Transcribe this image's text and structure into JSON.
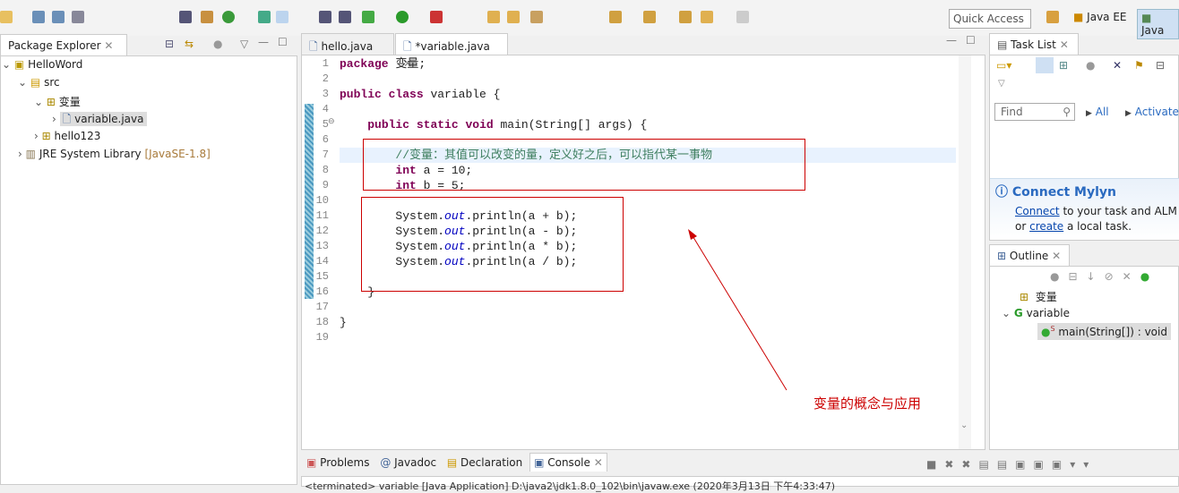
{
  "toolbar": {
    "quick_access": "Quick Access",
    "perspectives": [
      "Java EE",
      "Java"
    ]
  },
  "package_explorer": {
    "title": "Package Explorer",
    "tree": [
      {
        "label": "HelloWord",
        "depth": 0
      },
      {
        "label": "src",
        "depth": 1
      },
      {
        "label": "变量",
        "depth": 2
      },
      {
        "label": "variable.java",
        "depth": 3
      },
      {
        "label": "hello123",
        "depth": 2
      },
      {
        "label": "JRE System Library",
        "suffix": "[JavaSE-1.8]",
        "depth": 0
      }
    ]
  },
  "editor": {
    "tabs": [
      {
        "label": "hello.java"
      },
      {
        "label": "*variable.java"
      }
    ],
    "lines": [
      "package 变量;",
      "",
      "public class variable {",
      "",
      "    public static void main(String[] args) {",
      "",
      "        //变量：其值可以改变的量，定义好之后，可以指代某一事物",
      "        int a = 10;",
      "        int b = 5;",
      "",
      "        System.out.println(a + b);",
      "        System.out.println(a - b);",
      "        System.out.println(a * b);",
      "        System.out.println(a / b);",
      "",
      "    }",
      "",
      "}",
      ""
    ],
    "annotation": "变量的概念与应用"
  },
  "task_list": {
    "title": "Task List",
    "find_placeholder": "Find",
    "all": "All",
    "activate": "Activate...",
    "mylyn_title": "Connect Mylyn",
    "mylyn_connect": "Connect",
    "mylyn_text1": " to your task and ALM t",
    "mylyn_or": "or ",
    "mylyn_create": "create",
    "mylyn_text2": " a local task."
  },
  "outline": {
    "title": "Outline",
    "items": [
      "变量",
      "variable",
      "main(String[]) : void"
    ]
  },
  "bottom": {
    "tabs": [
      "Problems",
      "Javadoc",
      "Declaration",
      "Console"
    ],
    "console_text": "<terminated> variable [Java Application] D:\\java2\\jdk1.8.0_102\\bin\\javaw.exe (2020年3月13日 下午4:33:47)"
  }
}
